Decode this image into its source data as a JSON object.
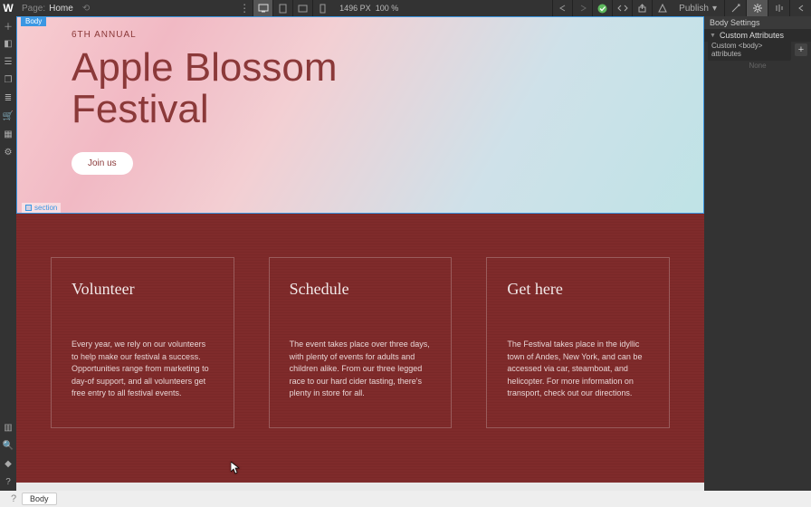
{
  "topbar": {
    "page_label": "Page:",
    "page_name": "Home",
    "dimensions": "1496 PX",
    "zoom": "100 %",
    "publish_label": "Publish"
  },
  "selection_tag": "Body",
  "hover_tag": "section",
  "hero": {
    "kicker": "6TH ANNUAL",
    "title_line1": "Apple Blossom",
    "title_line2": "Festival",
    "cta": "Join us"
  },
  "cards": [
    {
      "title": "Volunteer",
      "body": "Every year, we rely on our volunteers to help make our festival a success. Opportunities range from marketing to day-of support, and all volunteers get free entry to all festival events."
    },
    {
      "title": "Schedule",
      "body": "The event takes place over three days, with plenty of events for adults and children alike. From our three legged race to our hard cider tasting, there's plenty in store for all."
    },
    {
      "title": "Get here",
      "body": "The Festival takes place in the idyllic town of Andes, New York, and can be accessed via car, steamboat, and helicopter. For more information on transport, check out our directions."
    }
  ],
  "right_panel": {
    "settings_header": "Body Settings",
    "custom_attrs_header": "Custom Attributes",
    "custom_attrs_label": "Custom <body> attributes",
    "empty_text": "None"
  },
  "bottom": {
    "crumb": "Body"
  }
}
